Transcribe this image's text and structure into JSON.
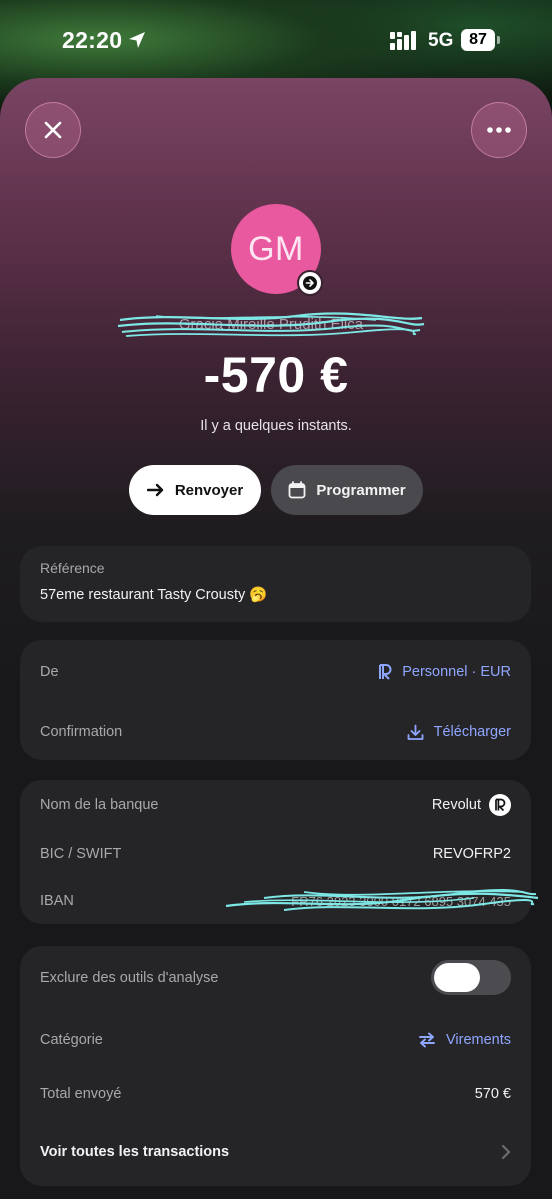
{
  "status_bar": {
    "time": "22:20",
    "network": "5G",
    "battery": "87"
  },
  "header": {
    "avatar_initials": "GM",
    "recipient_name": "Gracia Mireille Prudith Elica",
    "amount": "-570 €",
    "timestamp": "Il y a quelques instants."
  },
  "actions": {
    "resend_label": "Renvoyer",
    "schedule_label": "Programmer"
  },
  "reference": {
    "label": "Référence",
    "value": "57eme restaurant Tasty Crousty 🥱"
  },
  "from": {
    "label": "De",
    "account": "Personnel · EUR",
    "confirmation_label": "Confirmation",
    "download_label": "Télécharger"
  },
  "bank": {
    "name_label": "Nom de la banque",
    "name_value": "Revolut",
    "bic_label": "BIC / SWIFT",
    "bic_value": "REVOFRP2",
    "iban_label": "IBAN",
    "iban_value": "FR76 2823 3000 0172 6895 3074 435"
  },
  "details": {
    "analytics_label": "Exclure des outils d'analyse",
    "analytics_enabled": false,
    "category_label": "Catégorie",
    "category_value": "Virements",
    "total_label": "Total envoyé",
    "total_value": "570 €",
    "all_transactions_label": "Voir toutes les transactions"
  },
  "colors": {
    "accent_blue": "#8fa6ff",
    "avatar_pink": "#e9599f",
    "redaction_cyan": "#7de8e6",
    "card_bg": "#252527"
  }
}
